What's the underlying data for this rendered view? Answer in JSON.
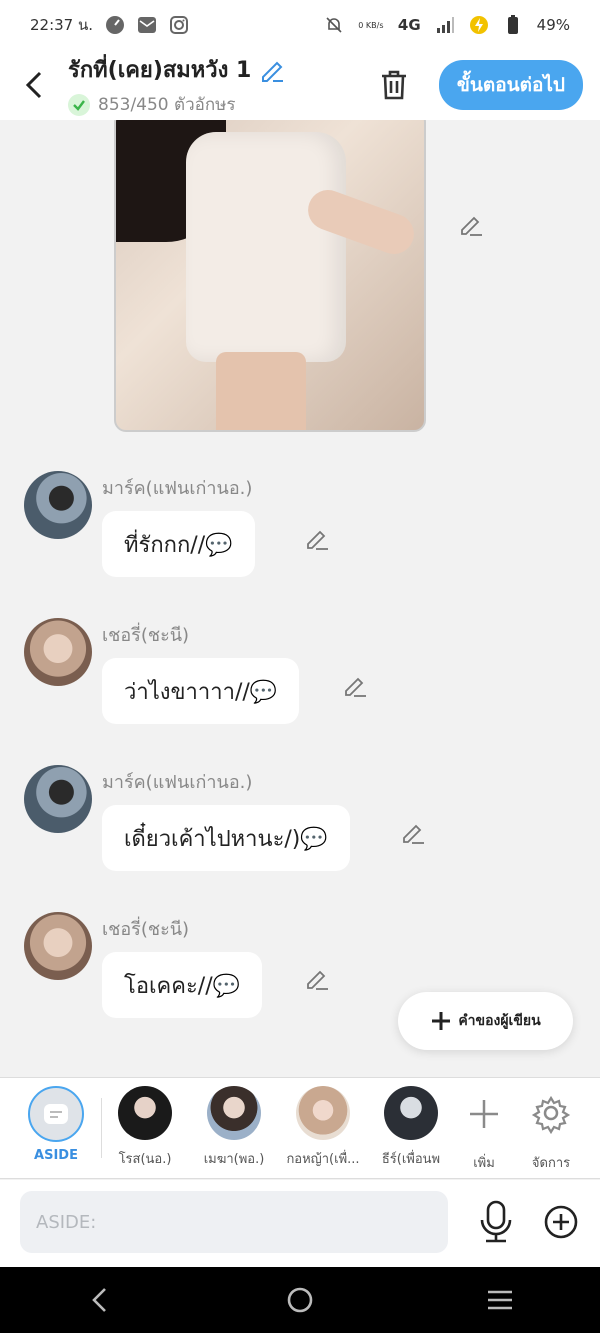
{
  "status_bar": {
    "time": "22:37 น.",
    "speed": "0 KB/s",
    "network": "4G",
    "battery": "49%"
  },
  "header": {
    "title": "รักที่(เคย)สมหวัง 1",
    "char_count": "853/450 ตัวอักษร",
    "next_label": "ขั้นตอนต่อไป"
  },
  "messages": [
    {
      "sender": "มาร์ค(แฟนเก่านอ.)",
      "text": "ที่รักกก//💬"
    },
    {
      "sender": "เชอรี่(ชะนี)",
      "text": "ว่าไงขาาาา//💬"
    },
    {
      "sender": "มาร์ค(แฟนเก่านอ.)",
      "text": "เดี๋ยวเค้าไปหานะ/)💬"
    },
    {
      "sender": "เชอรี่(ชะนี)",
      "text": "โอเคคะ//💬"
    }
  ],
  "author_button": "คำของผู้เขียน",
  "characters": [
    {
      "label": "ASIDE"
    },
    {
      "label": "โรส(นอ.)"
    },
    {
      "label": "เมฆา(พอ.)"
    },
    {
      "label": "กอหญ้า(เพื่..."
    },
    {
      "label": "ธีร์(เพื่อนพ"
    }
  ],
  "char_actions": {
    "add": "เพิ่ม",
    "manage": "จัดการ"
  },
  "input": {
    "placeholder": "ASIDE:"
  },
  "colors": {
    "accent": "#4aa6ef",
    "background": "#f2f2f2"
  }
}
